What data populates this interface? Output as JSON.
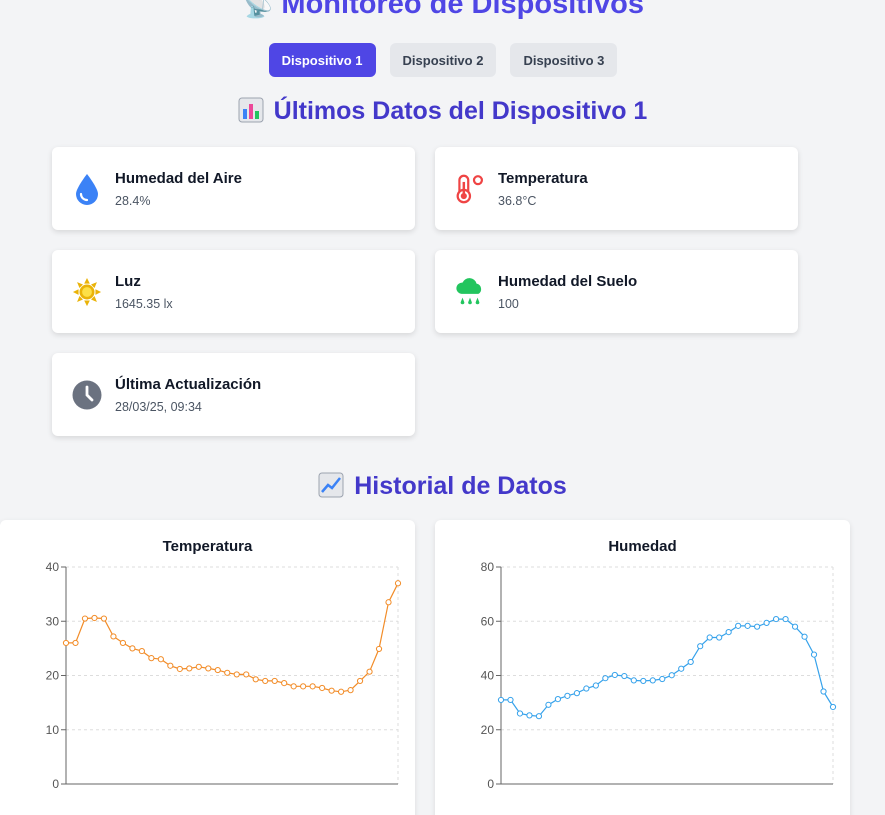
{
  "header": {
    "emoji": "📡",
    "title": "Monitoreo de Dispositivos"
  },
  "tabs": [
    {
      "label": "Dispositivo 1",
      "active": true
    },
    {
      "label": "Dispositivo 2",
      "active": false
    },
    {
      "label": "Dispositivo 3",
      "active": false
    }
  ],
  "latest": {
    "title": "Últimos Datos del Dispositivo 1",
    "cards": [
      {
        "icon": "water-drop-icon",
        "label": "Humedad del Aire",
        "value": "28.4%"
      },
      {
        "icon": "thermometer-icon",
        "label": "Temperatura",
        "value": "36.8°C"
      },
      {
        "icon": "sun-icon",
        "label": "Luz",
        "value": "1645.35 lx"
      },
      {
        "icon": "rain-cloud-icon",
        "label": "Humedad del Suelo",
        "value": "100"
      },
      {
        "icon": "clock-icon",
        "label": "Última Actualización",
        "value": "28/03/25, 09:34"
      }
    ]
  },
  "history": {
    "title": "Historial de Datos"
  },
  "colors": {
    "accent": "#4f46e5",
    "temperature_line": "#f28c28",
    "humidity_line": "#36a2eb",
    "drop_icon": "#3b82f6",
    "thermo_icon": "#ef4444",
    "sun_icon": "#eab308",
    "cloud_icon": "#22c55e",
    "clock_icon": "#6b7280"
  },
  "chart_data": [
    {
      "type": "line",
      "title": "Temperatura",
      "ylim": [
        0,
        40
      ],
      "yticks": [
        0,
        10,
        20,
        30,
        40
      ],
      "grid": true,
      "series": [
        {
          "values": [
            26,
            26,
            30.5,
            30.6,
            30.5,
            27.2,
            26,
            25,
            24.5,
            23.2,
            23,
            21.8,
            21.2,
            21.3,
            21.6,
            21.3,
            21,
            20.5,
            20.2,
            20.2,
            19.3,
            19,
            19,
            18.6,
            18,
            18,
            18,
            17.7,
            17.2,
            17,
            17.3,
            19,
            20.7,
            24.9,
            33.5,
            37
          ]
        }
      ]
    },
    {
      "type": "line",
      "title": "Humedad",
      "ylim": [
        0,
        80
      ],
      "yticks": [
        0,
        20,
        40,
        60,
        80
      ],
      "grid": true,
      "series": [
        {
          "values": [
            31,
            31,
            26,
            25.3,
            25,
            29.2,
            31.3,
            32.5,
            33.5,
            35.2,
            36.3,
            39,
            40.2,
            39.8,
            38.2,
            38,
            38.2,
            38.7,
            40.1,
            42.5,
            45,
            50.8,
            54,
            54,
            56,
            58.3,
            58.3,
            58,
            59.4,
            60.8,
            60.8,
            58,
            54.3,
            47.7,
            34.1,
            28.4
          ]
        }
      ]
    }
  ]
}
